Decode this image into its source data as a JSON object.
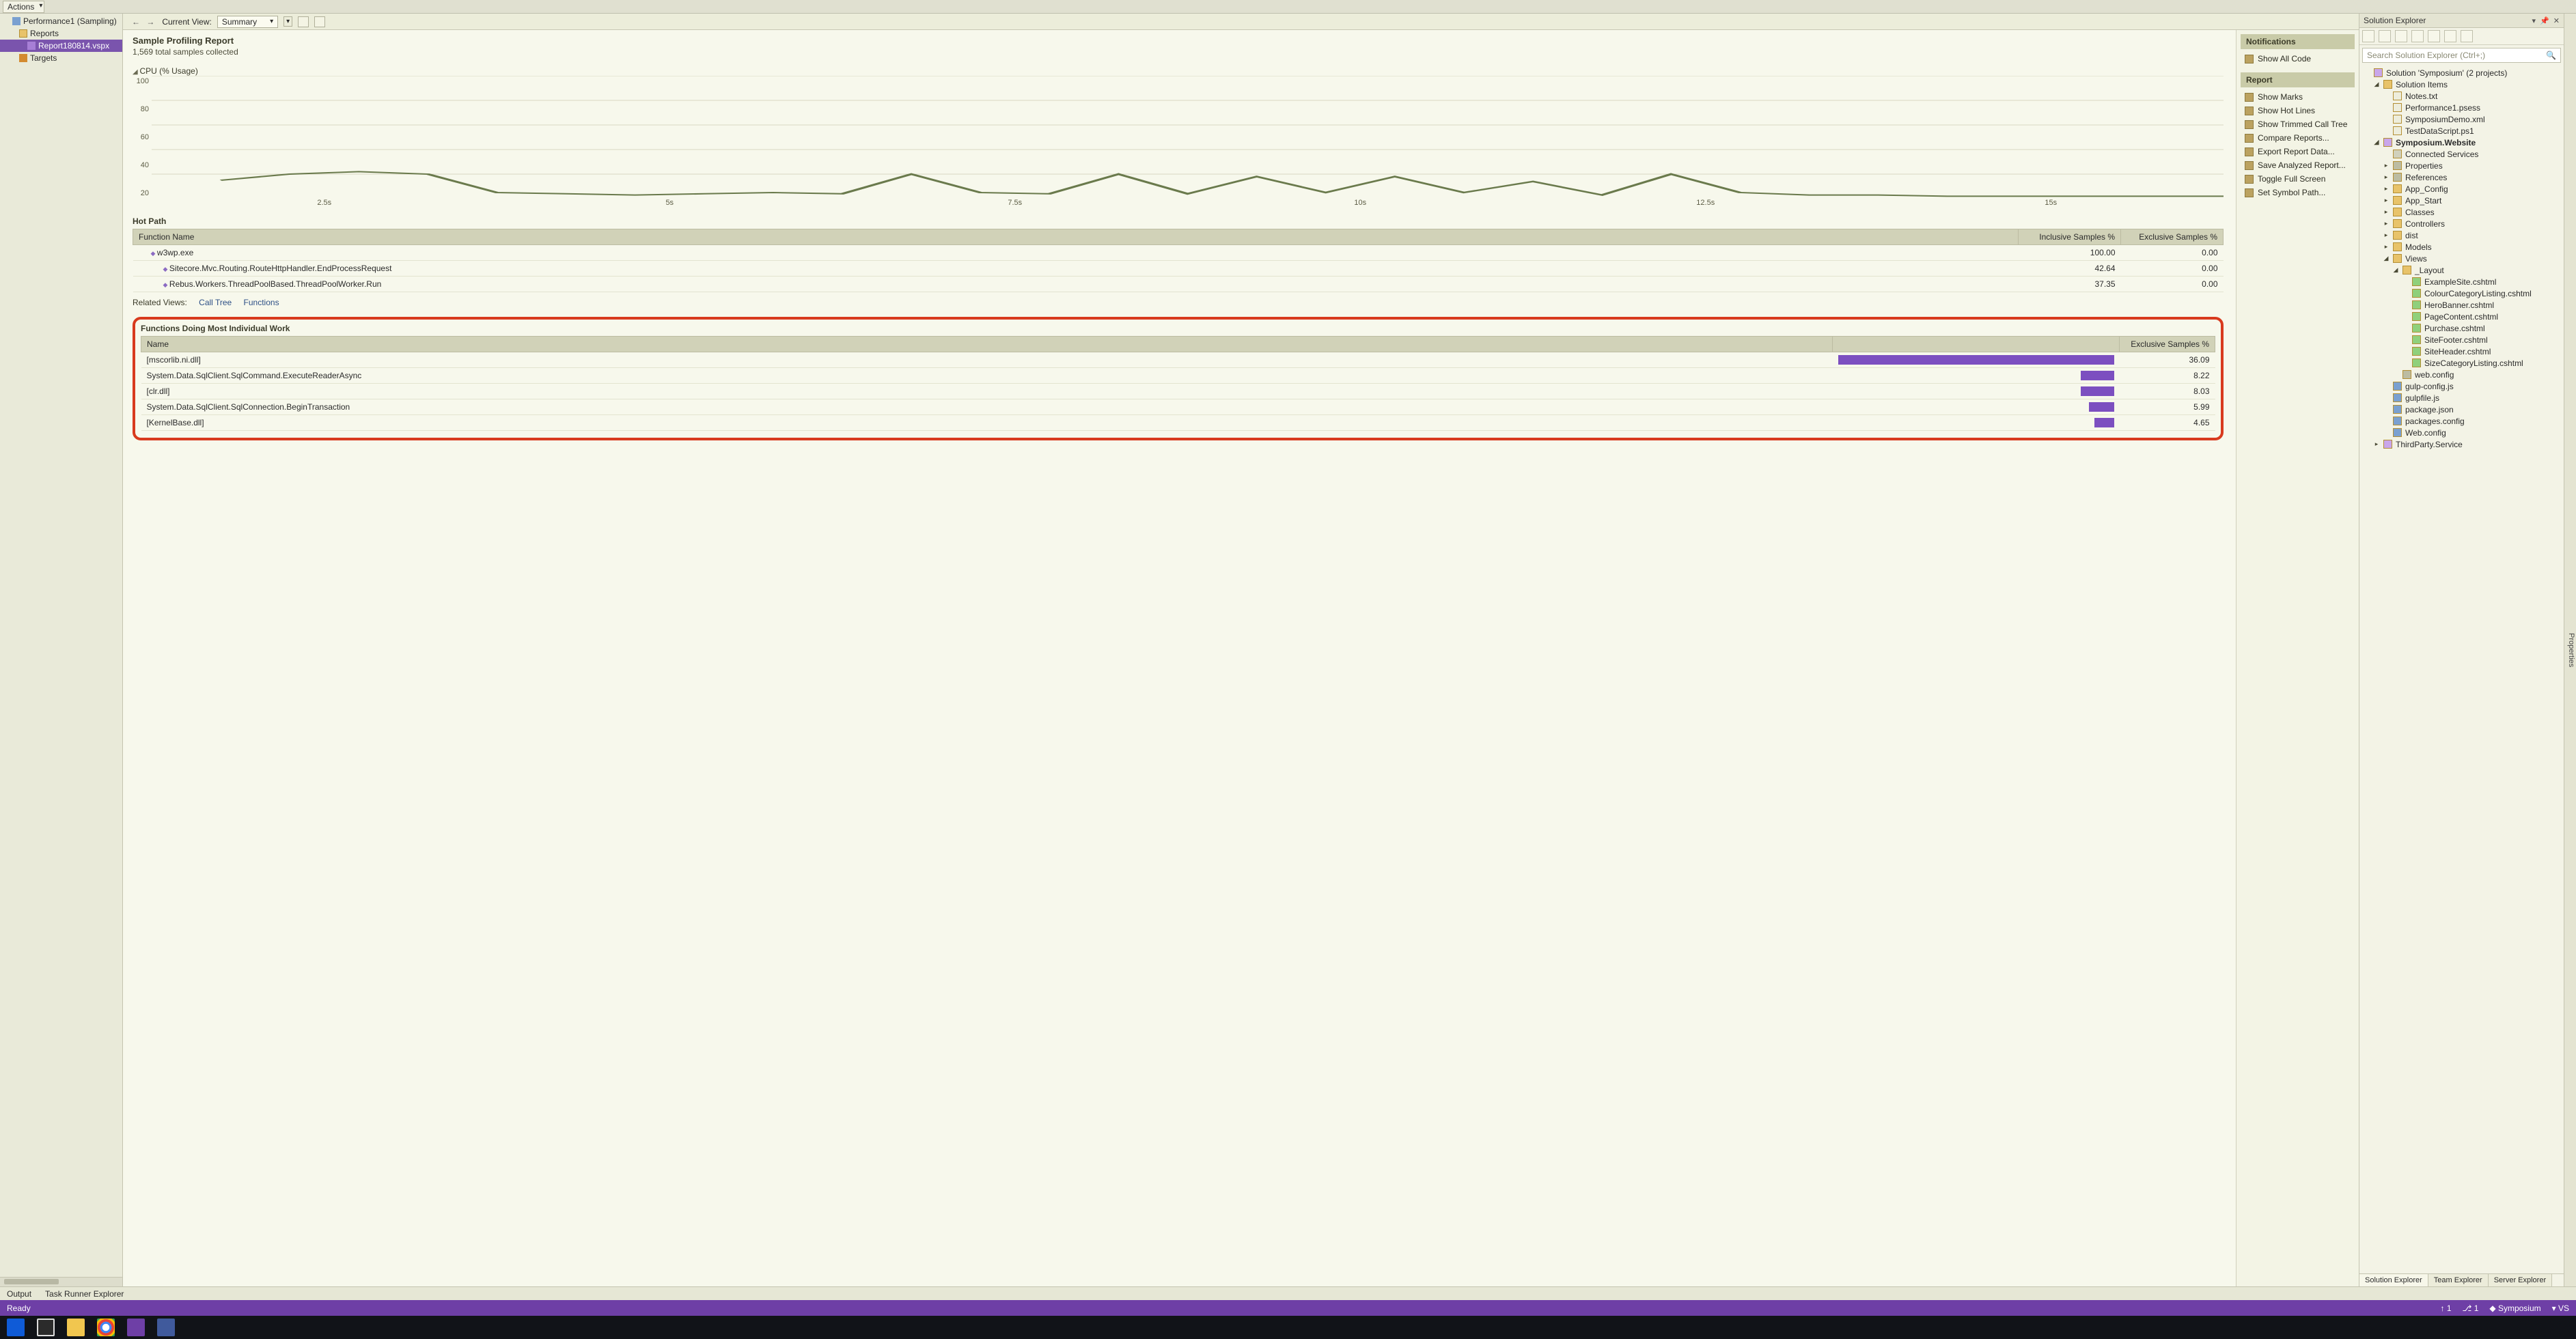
{
  "topstrip": {
    "actions_label": "Actions"
  },
  "perf_tree": {
    "session": "Performance1 (Sampling)",
    "reports_label": "Reports",
    "report_file": "Report180814.vspx",
    "targets_label": "Targets"
  },
  "doc_toolbar": {
    "current_view_label": "Current View:",
    "current_view_value": "Summary"
  },
  "report": {
    "title": "Sample Profiling Report",
    "subtitle": "1,569 total samples collected",
    "chart_title": "CPU (% Usage)"
  },
  "chart_y": [
    "100",
    "80",
    "60",
    "40",
    "20"
  ],
  "chart_x": [
    "2.5s",
    "5s",
    "7.5s",
    "10s",
    "12.5s",
    "15s"
  ],
  "hotpath": {
    "title": "Hot Path",
    "col_name": "Function Name",
    "col_inc": "Inclusive Samples %",
    "col_exc": "Exclusive Samples %",
    "rows": [
      {
        "name": "w3wp.exe",
        "inc": "100.00",
        "exc": "0.00",
        "ind": "ind1"
      },
      {
        "name": "Sitecore.Mvc.Routing.RouteHttpHandler.EndProcessRequest",
        "inc": "42.64",
        "exc": "0.00",
        "ind": "ind2"
      },
      {
        "name": "Rebus.Workers.ThreadPoolBased.ThreadPoolWorker.Run",
        "inc": "37.35",
        "exc": "0.00",
        "ind": "ind2"
      }
    ]
  },
  "related": {
    "label": "Related Views:",
    "link1": "Call Tree",
    "link2": "Functions"
  },
  "funcs": {
    "title": "Functions Doing Most Individual Work",
    "col_name": "Name",
    "col_exc": "Exclusive Samples %",
    "rows": [
      {
        "name": "[mscorlib.ni.dll]",
        "pct": "36.09",
        "bar": 100
      },
      {
        "name": "System.Data.SqlClient.SqlCommand.ExecuteReaderAsync",
        "pct": "8.22",
        "bar": 12
      },
      {
        "name": "[clr.dll]",
        "pct": "8.03",
        "bar": 12
      },
      {
        "name": "System.Data.SqlClient.SqlConnection.BeginTransaction",
        "pct": "5.99",
        "bar": 9
      },
      {
        "name": "[KernelBase.dll]",
        "pct": "4.65",
        "bar": 7
      }
    ]
  },
  "side": {
    "notif_header": "Notifications",
    "show_all_code": "Show All Code",
    "report_header": "Report",
    "links": [
      "Show Marks",
      "Show Hot Lines",
      "Show Trimmed Call Tree",
      "Compare Reports...",
      "Export Report Data...",
      "Save Analyzed Report...",
      "Toggle Full Screen",
      "Set Symbol Path..."
    ]
  },
  "sol": {
    "title": "Solution Explorer",
    "search_placeholder": "Search Solution Explorer (Ctrl+;)",
    "root": "Solution 'Symposium' (2 projects)",
    "solution_items": "Solution Items",
    "items": [
      "Notes.txt",
      "Performance1.psess",
      "SymposiumDemo.xml",
      "TestDataScript.ps1"
    ],
    "website": "Symposium.Website",
    "connected": "Connected Services",
    "properties": "Properties",
    "references": "References",
    "folders": [
      "App_Config",
      "App_Start",
      "Classes",
      "Controllers",
      "dist",
      "Models"
    ],
    "views": "Views",
    "layout": "_Layout",
    "cshtml": [
      "ExampleSite.cshtml",
      "ColourCategoryListing.cshtml",
      "HeroBanner.cshtml",
      "PageContent.cshtml",
      "Purchase.cshtml",
      "SiteFooter.cshtml",
      "SiteHeader.cshtml",
      "SizeCategoryListing.cshtml"
    ],
    "webconfig_views": "web.config",
    "roots2": [
      "gulp-config.js",
      "gulpfile.js",
      "package.json",
      "packages.config",
      "Web.config"
    ],
    "project2": "ThirdParty.Service",
    "tabs": {
      "t1": "Solution Explorer",
      "t2": "Team Explorer",
      "t3": "Server Explorer"
    }
  },
  "properties_tab": "Properties",
  "bottom_tabs": {
    "output": "Output",
    "task_runner": "Task Runner Explorer"
  },
  "statusbar": {
    "ready": "Ready",
    "branch": "Symposium",
    "vs": "VS"
  },
  "chart_data": {
    "type": "line",
    "title": "CPU (% Usage)",
    "xlabel": "",
    "ylabel": "% Usage",
    "ylim": [
      0,
      100
    ],
    "x_seconds": [
      0.5,
      1.0,
      1.5,
      2.0,
      2.5,
      3.0,
      3.5,
      4.0,
      4.5,
      5.0,
      5.5,
      6.0,
      6.5,
      7.0,
      7.5,
      8.0,
      8.5,
      9.0,
      9.5,
      10.0,
      10.5,
      11.0,
      11.5,
      12.0,
      12.5,
      13.0,
      13.5,
      14.0,
      14.5,
      15.0
    ],
    "values": [
      15,
      20,
      22,
      20,
      5,
      4,
      3,
      4,
      5,
      4,
      20,
      5,
      4,
      20,
      4,
      18,
      5,
      18,
      5,
      14,
      3,
      20,
      5,
      3,
      3,
      2,
      2,
      2,
      2,
      2
    ]
  }
}
